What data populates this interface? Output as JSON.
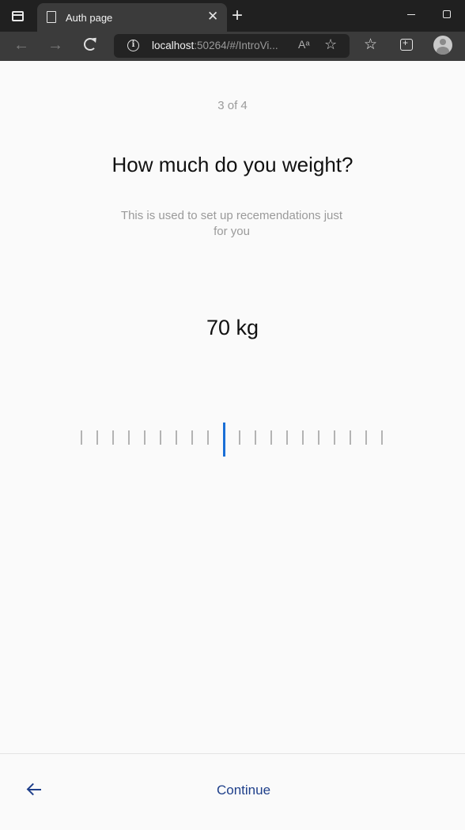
{
  "browser": {
    "tab_title": "Auth page",
    "url_host": "localhost",
    "url_rest": ":50264/#/IntroVi...",
    "read_aloud_glyph": "Aᵃ"
  },
  "page": {
    "step_label": "3 of 4",
    "title": "How much do you weight?",
    "subtitle": "This is used to set up recemendations just for you",
    "weight_value": "70 kg",
    "continue_label": "Continue"
  },
  "ruler": {
    "tick_count": 20,
    "selected_index": 9,
    "accent_color": "#1a6fd6",
    "tick_color": "#b3b3b3"
  },
  "colors": {
    "primary": "#1e3f8a",
    "muted_text": "#9a9a9a"
  }
}
